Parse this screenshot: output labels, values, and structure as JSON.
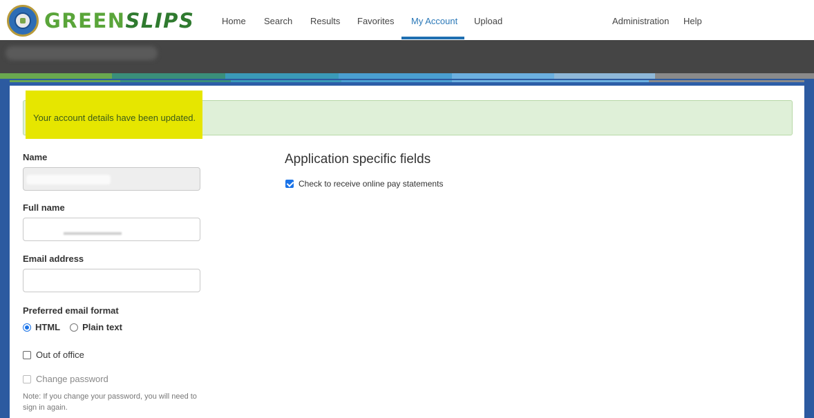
{
  "app": {
    "logo_text_primary": "GREEN",
    "logo_text_secondary": "SLIPS"
  },
  "nav": {
    "items": [
      {
        "label": "Home"
      },
      {
        "label": "Search"
      },
      {
        "label": "Results"
      },
      {
        "label": "Favorites"
      },
      {
        "label": "My Account",
        "active": true
      },
      {
        "label": "Upload"
      }
    ],
    "right_items": [
      {
        "label": "Administration"
      },
      {
        "label": "Help"
      }
    ]
  },
  "alert": {
    "message": "Your account details have been updated."
  },
  "form": {
    "name_label": "Name",
    "name_value": "",
    "full_name_label": "Full name",
    "full_name_value": "",
    "email_label": "Email address",
    "email_value": "",
    "email_format_label": "Preferred email format",
    "format_options": [
      {
        "label": "HTML",
        "selected": true
      },
      {
        "label": "Plain text",
        "selected": false
      }
    ],
    "out_of_office_label": "Out of office",
    "change_password_label": "Change password",
    "password_note": "Note: If you change your password, you will need to sign in again."
  },
  "app_fields": {
    "title": "Application specific fields",
    "pay_statements_label": "Check to receive online pay statements",
    "pay_statements_checked": true
  },
  "colors": {
    "accent": "#1f6fb1",
    "alert_bg": "#dff0d8",
    "highlight": "#e6e600",
    "banner": "#454545",
    "frame": "#2c5aa0"
  }
}
